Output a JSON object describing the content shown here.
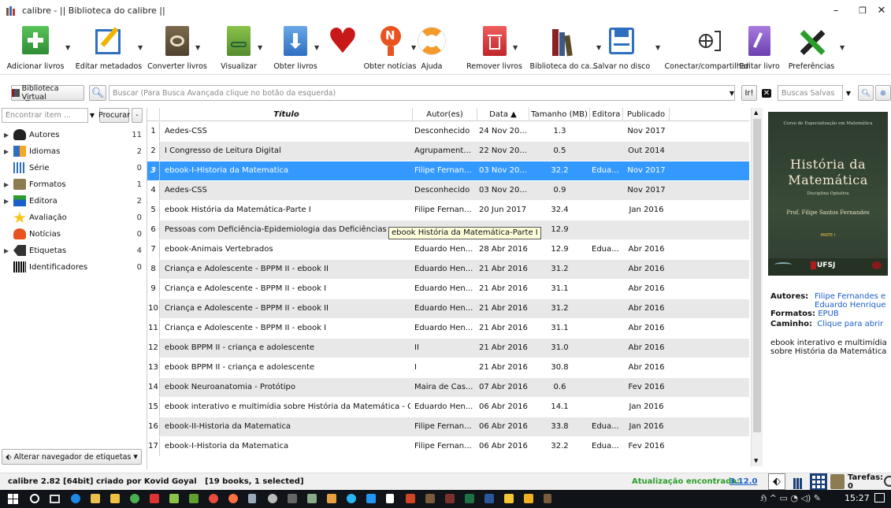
{
  "window": {
    "title": "calibre - || Biblioteca do calibre ||",
    "minimize": "–",
    "maximize": "❐",
    "close": "✕"
  },
  "toolbar": {
    "add": "Adicionar livros",
    "edit_meta": "Editar metadados",
    "convert": "Converter livros",
    "view": "Visualizar",
    "get_books": "Obter livros",
    "news": "Obter notícias",
    "help": "Ajuda",
    "remove": "Remover livros",
    "library": "Biblioteca do ca...",
    "save": "Salvar no disco",
    "connect": "Conectar/compartilhar",
    "edit_book": "Editar livro",
    "prefs": "Preferências"
  },
  "search": {
    "virtual_lib": "Biblioteca Vi̲rtual",
    "placeholder": "Buscar (Para Busca Avançada clique no botão da esquerda)",
    "saved_placeholder": "Buscas Salvas"
  },
  "tagbrowser": {
    "find_placeholder": "Encontrar item ...",
    "find_button": "Procurar",
    "minus": "-",
    "alter_button": "Alterar navegador de etiquetas",
    "items": [
      {
        "label": "Autores",
        "count": "11",
        "expandable": true,
        "icon": "person-icon"
      },
      {
        "label": "Idiomas",
        "count": "2",
        "expandable": true,
        "icon": "languages-icon"
      },
      {
        "label": "Série",
        "count": "0",
        "expandable": false,
        "icon": "series-icon"
      },
      {
        "label": "Formatos",
        "count": "1",
        "expandable": true,
        "icon": "formats-icon"
      },
      {
        "label": "Editora",
        "count": "2",
        "expandable": true,
        "icon": "publisher-icon"
      },
      {
        "label": "Avaliação",
        "count": "0",
        "expandable": false,
        "icon": "rating-star-icon"
      },
      {
        "label": "Notícias",
        "count": "0",
        "expandable": false,
        "icon": "news-icon"
      },
      {
        "label": "Etiquetas",
        "count": "4",
        "expandable": true,
        "icon": "tags-icon"
      },
      {
        "label": "Identificadores",
        "count": "0",
        "expandable": false,
        "icon": "barcode-icon"
      }
    ]
  },
  "table": {
    "headers": {
      "title": "Título",
      "author": "Autor(es)",
      "date": "Data ▲",
      "size": "Tamanho (MB)",
      "publisher": "Editora",
      "published": "Publicado"
    },
    "rows": [
      {
        "n": "1",
        "title": "Aedes-CSS",
        "author": "Desconhecido",
        "date": "24 Nov 20...",
        "size": "1.3",
        "publisher": "",
        "published": "Nov 2017"
      },
      {
        "n": "2",
        "title": "I Congresso de Leitura Digital",
        "author": "Agrupament...",
        "date": "22 Nov 20...",
        "size": "0.5",
        "publisher": "",
        "published": "Out 2014"
      },
      {
        "n": "3",
        "title": "ebook-I-Historia da Matematica",
        "author": "Filipe Fernan...",
        "date": "03 Nov 20...",
        "size": "32.2",
        "publisher": "Edua...",
        "published": "Nov 2017"
      },
      {
        "n": "4",
        "title": "Aedes-CSS",
        "author": "Desconhecido",
        "date": "03 Nov 20...",
        "size": "0.9",
        "publisher": "",
        "published": "Nov 2017"
      },
      {
        "n": "5",
        "title": "ebook História da Matemática-Parte I",
        "author": "Filipe Fernan...",
        "date": "20 Jun 2017",
        "size": "32.4",
        "publisher": "",
        "published": "Jan 2016"
      },
      {
        "n": "6",
        "title": "Pessoas com Deficiência-Epidemiologia das Deficiências",
        "author": "",
        "date": "",
        "size": "12.9",
        "publisher": "",
        "published": ""
      },
      {
        "n": "7",
        "title": "ebook-Animais Vertebrados",
        "author": "Eduardo Hen...",
        "date": "28 Abr 2016",
        "size": "12.9",
        "publisher": "Edua...",
        "published": "Abr 2016"
      },
      {
        "n": "8",
        "title": "Criança e Adolescente - BPPM II - ebook II",
        "author": "Eduardo Hen...",
        "date": "21 Abr 2016",
        "size": "31.2",
        "publisher": "",
        "published": "Abr 2016"
      },
      {
        "n": "9",
        "title": "Criança e Adolescente - BPPM II - ebook I",
        "author": "Eduardo Hen...",
        "date": "21 Abr 2016",
        "size": "31.1",
        "publisher": "",
        "published": "Abr 2016"
      },
      {
        "n": "10",
        "title": "Criança e Adolescente - BPPM II - ebook II",
        "author": "Eduardo Hen...",
        "date": "21 Abr 2016",
        "size": "31.2",
        "publisher": "",
        "published": "Abr 2016"
      },
      {
        "n": "11",
        "title": "Criança e Adolescente - BPPM II - ebook I",
        "author": "Eduardo Hen...",
        "date": "21 Abr 2016",
        "size": "31.1",
        "publisher": "",
        "published": "Abr 2016"
      },
      {
        "n": "12",
        "title": "ebook BPPM II - criança e adolescente",
        "author": "II",
        "date": "21 Abr 2016",
        "size": "31.0",
        "publisher": "",
        "published": "Abr 2016"
      },
      {
        "n": "13",
        "title": "ebook BPPM II - criança e adolescente",
        "author": "I",
        "date": "21 Abr 2016",
        "size": "30.8",
        "publisher": "",
        "published": "Abr 2016"
      },
      {
        "n": "14",
        "title": "ebook Neuroanatomia - Protótipo",
        "author": "Maira de Cas...",
        "date": "07 Abr 2016",
        "size": "0.6",
        "publisher": "",
        "published": "Fev 2016"
      },
      {
        "n": "15",
        "title": "ebook interativo e multimídia sobre História da Matemática - Game",
        "author": "Eduardo Hen...",
        "date": "06 Abr 2016",
        "size": "14.1",
        "publisher": "",
        "published": "Jan 2016"
      },
      {
        "n": "16",
        "title": "ebook-II-Historia da Matematica",
        "author": "Filipe Fernan...",
        "date": "06 Abr 2016",
        "size": "33.8",
        "publisher": "Edua...",
        "published": "Jan 2016"
      },
      {
        "n": "17",
        "title": "ebook-I-Historia da Matematica",
        "author": "Filipe Fernan...",
        "date": "06 Abr 2016",
        "size": "32.2",
        "publisher": "Edua...",
        "published": "Fev 2016"
      }
    ],
    "tooltip": "ebook História da Matemática-Parte I"
  },
  "details": {
    "cover": {
      "course": "Curso de Especialização em Matemática",
      "title_line1": "História da",
      "title_line2": "Matemática",
      "subtitle": "Disciplina Optativa",
      "author": "Prof. Filipe Santos Fernandes",
      "part": "PARTE I",
      "univ": "UFSJ"
    },
    "authors_label": "Autores:",
    "authors_value": "Filipe Fernandes e Eduardo Henrique",
    "formats_label": "Formatos:",
    "formats_value": "EPUB",
    "path_label": "Caminho:",
    "path_value": "Clique para abrir",
    "comments": "ebook interativo e multimídia sobre História da Matemática"
  },
  "status": {
    "left": "calibre 2.82 [64bit] criado por Kovid Goyal   [19 books, 1 selected]",
    "update_label": "Atualização encontrada:",
    "update_version": "3.12.0",
    "jobs": "Tarefas: 0"
  },
  "taskbar": {
    "time": "15:27"
  },
  "colors": {
    "selection": "#3399ff",
    "update_green": "#2a9d2a",
    "link_blue": "#1a5fc8"
  }
}
